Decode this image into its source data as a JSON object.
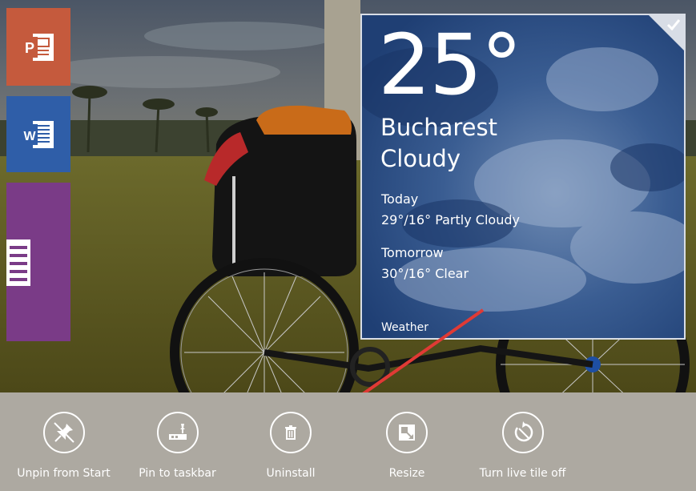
{
  "weather_tile": {
    "temperature": "25°",
    "city": "Bucharest",
    "condition": "Cloudy",
    "forecast": [
      {
        "day": "Today",
        "summary": "29°/16° Partly Cloudy"
      },
      {
        "day": "Tomorrow",
        "summary": "30°/16° Clear"
      }
    ],
    "app_name": "Weather",
    "selected": true
  },
  "app_tiles": [
    {
      "name": "PowerPoint",
      "letter": "P",
      "color": "#c55a3d"
    },
    {
      "name": "Word",
      "letter": "W",
      "color": "#2f5ea8"
    },
    {
      "name": "OneNote",
      "color": "#7a3b87"
    }
  ],
  "app_bar": {
    "commands": [
      {
        "label": "Unpin from Start",
        "icon": "unpin-icon"
      },
      {
        "label": "Pin to taskbar",
        "icon": "pin-taskbar-icon"
      },
      {
        "label": "Uninstall",
        "icon": "trash-icon"
      },
      {
        "label": "Resize",
        "icon": "resize-icon"
      },
      {
        "label": "Turn live tile off",
        "icon": "live-tile-off-icon"
      }
    ]
  },
  "colors": {
    "app_bar_bg": "#ada9a1",
    "arrow": "#e03a35",
    "tile_border": "#d8dde6"
  }
}
